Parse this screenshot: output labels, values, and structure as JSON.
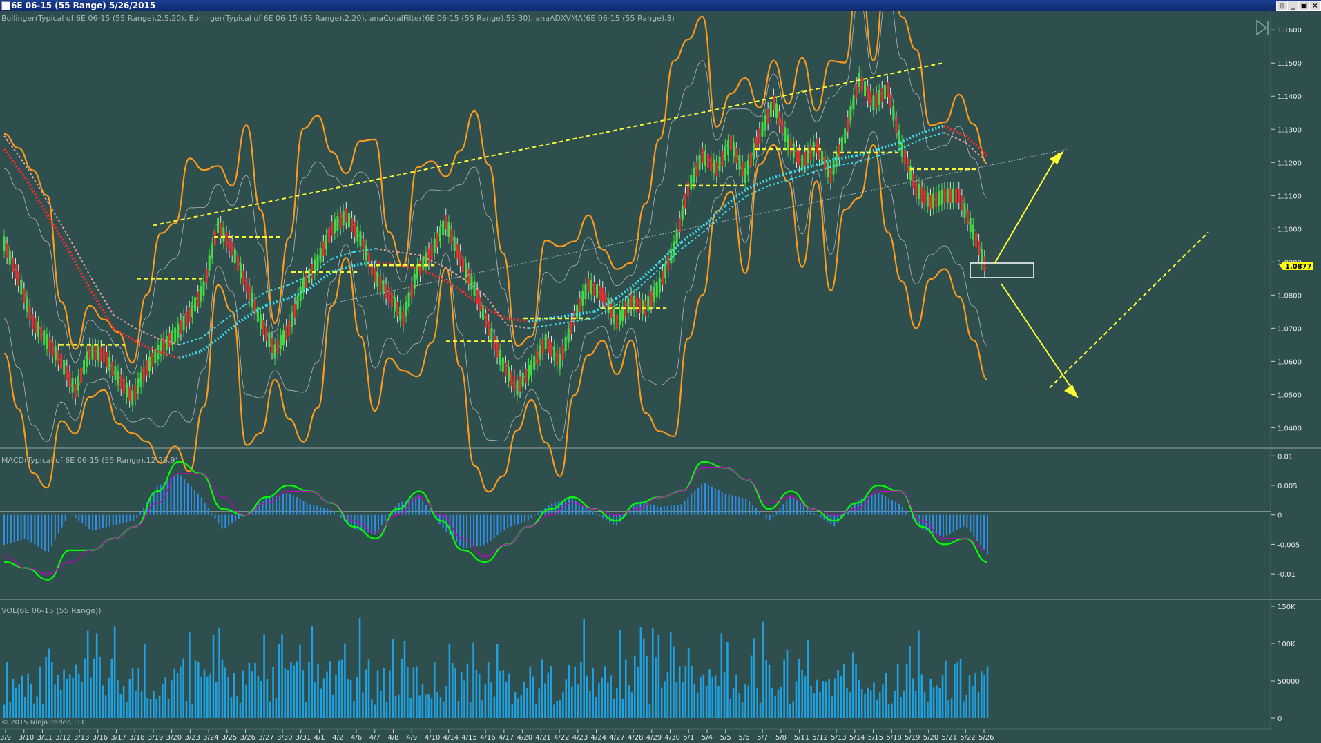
{
  "window": {
    "title": "6E 06-15 (55 Range)  5/26/2015",
    "buttons": [
      "▯",
      "_",
      "▣",
      "×"
    ]
  },
  "chart_data": [
    {
      "type": "line",
      "panel": "price",
      "indicator_label": "Bollinger(Typical of 6E 06-15 (55 Range),2.5,20), Bollinger(Typical of 6E 06-15 (55 Range),2,20), anaCoralFilter(6E 06-15 (55 Range),55,30), anaADXVMA(6E 06-15 (55 Range),8)",
      "y_ticks": [
        "1.1600",
        "1.1500",
        "1.1400",
        "1.1300",
        "1.1200",
        "1.1100",
        "1.1000",
        "1.0900",
        "1.0800",
        "1.0700",
        "1.0600",
        "1.0500",
        "1.0400"
      ],
      "ylim": [
        1.0355,
        1.1615
      ],
      "last_price": "1.0877",
      "price_path": [
        1.0955,
        1.085,
        1.072,
        1.066,
        1.06,
        1.051,
        1.063,
        1.062,
        1.055,
        1.049,
        1.058,
        1.064,
        1.068,
        1.074,
        1.082,
        1.101,
        1.094,
        1.083,
        1.072,
        1.063,
        1.07,
        1.083,
        1.09,
        1.1,
        1.104,
        1.097,
        1.086,
        1.08,
        1.073,
        1.087,
        1.093,
        1.102,
        1.091,
        1.082,
        1.07,
        1.059,
        1.052,
        1.058,
        1.066,
        1.06,
        1.073,
        1.083,
        1.08,
        1.072,
        1.078,
        1.076,
        1.083,
        1.094,
        1.112,
        1.122,
        1.118,
        1.126,
        1.116,
        1.128,
        1.138,
        1.126,
        1.12,
        1.125,
        1.116,
        1.128,
        1.145,
        1.138,
        1.142,
        1.124,
        1.112,
        1.108,
        1.11,
        1.11,
        1.099,
        1.087
      ],
      "coral_filter": [
        1.124,
        1.115,
        1.104,
        1.093,
        1.081,
        1.07,
        1.066,
        1.063,
        1.061,
        1.063,
        1.068,
        1.073,
        1.077,
        1.079,
        1.082,
        1.087,
        1.089,
        1.09,
        1.089,
        1.088,
        1.085,
        1.081,
        1.076,
        1.073,
        1.072,
        1.073,
        1.074,
        1.075,
        1.079,
        1.084,
        1.09,
        1.096,
        1.101,
        1.107,
        1.112,
        1.115,
        1.117,
        1.119,
        1.121,
        1.122,
        1.124,
        1.126,
        1.129,
        1.131,
        1.128,
        1.122
      ],
      "adxvma_levels": [
        1.065,
        1.085,
        1.0975,
        1.087,
        1.089,
        1.066,
        1.073,
        1.076,
        1.113,
        1.124,
        1.123,
        1.118
      ],
      "channel_lines": [
        {
          "from": [
            1.101,
            "3/19"
          ],
          "to": [
            1.15,
            "5/20"
          ],
          "style": "dashed"
        },
        {
          "from": [
            1.052,
            "4/13"
          ],
          "to": [
            1.099,
            "6/1"
          ],
          "style": "dashed"
        }
      ],
      "annotations": [
        "arrow-up-target",
        "arrow-down-target",
        "breakout-box"
      ]
    },
    {
      "type": "line",
      "panel": "macd",
      "indicator_label": "MACD(Typical of 6E 06-15 (55 Range),12,26,9)",
      "y_ticks": [
        "0.01",
        "0.005",
        "0",
        "-0.005",
        "-0.01"
      ],
      "ylim": [
        -0.0135,
        0.0105
      ],
      "series": [
        {
          "name": "MACD",
          "color": "#00ff00",
          "values": [
            -0.008,
            -0.009,
            -0.011,
            -0.006,
            -0.006,
            -0.004,
            -0.002,
            0.004,
            0.009,
            0.007,
            0.001,
            0.0,
            0.003,
            0.005,
            0.004,
            0.002,
            -0.002,
            -0.004,
            0.001,
            0.004,
            -0.001,
            -0.006,
            -0.008,
            -0.005,
            -0.002,
            0.001,
            0.003,
            0.001,
            -0.001,
            0.002,
            0.003,
            0.004,
            0.009,
            0.008,
            0.006,
            0.001,
            0.004,
            0.001,
            -0.001,
            0.002,
            0.005,
            0.004,
            -0.002,
            -0.005,
            -0.004,
            -0.008
          ]
        },
        {
          "name": "Signal",
          "color": "#c000c0",
          "values": [
            -0.007,
            -0.009,
            -0.01,
            -0.008,
            -0.006,
            -0.004,
            -0.002,
            0.002,
            0.007,
            0.007,
            0.003,
            0.0,
            0.002,
            0.004,
            0.004,
            0.002,
            -0.001,
            -0.003,
            0.0,
            0.003,
            0.0,
            -0.004,
            -0.007,
            -0.005,
            -0.002,
            0.0,
            0.002,
            0.001,
            0.0,
            0.001,
            0.003,
            0.004,
            0.008,
            0.008,
            0.006,
            0.002,
            0.003,
            0.001,
            0.0,
            0.001,
            0.004,
            0.004,
            -0.001,
            -0.004,
            -0.004,
            -0.006
          ]
        }
      ]
    },
    {
      "type": "bar",
      "panel": "volume",
      "indicator_label": "VOL(6E 06-15 (55 Range))",
      "y_ticks": [
        "150K",
        "100K",
        "50000",
        "0"
      ],
      "ylim": [
        0,
        150000
      ]
    }
  ],
  "x_labels": [
    "3/9",
    "3/10",
    "3/11",
    "3/12",
    "3/13",
    "3/16",
    "3/17",
    "3/18",
    "3/19",
    "3/20",
    "3/23",
    "3/24",
    "3/25",
    "3/26",
    "3/27",
    "3/30",
    "3/31",
    "4/1",
    "4/2",
    "4/6",
    "4/7",
    "4/8",
    "4/9",
    "4/10",
    "4/14",
    "4/15",
    "4/16",
    "4/17",
    "4/20",
    "4/21",
    "4/22",
    "4/23",
    "4/24",
    "4/27",
    "4/28",
    "4/29",
    "4/30",
    "5/1",
    "5/4",
    "5/5",
    "5/6",
    "5/7",
    "5/8",
    "5/11",
    "5/12",
    "5/13",
    "5/14",
    "5/15",
    "5/18",
    "5/19",
    "5/20",
    "5/21",
    "5/22",
    "5/26"
  ],
  "copyright": "© 2015 NinjaTrader, LLC",
  "colors": {
    "background": "#2f4f4f",
    "bollinger_outer": "#ff9a1a",
    "bollinger_inner": "#b8b8b8",
    "coral": "#40e0f0",
    "adxvma": "#ffff33",
    "trend_down": "#ff2a2a",
    "channel": "#ffff33",
    "volume": "#1fa0e0",
    "histogram": "#2e8fe8",
    "arrow": "#ffff33"
  }
}
